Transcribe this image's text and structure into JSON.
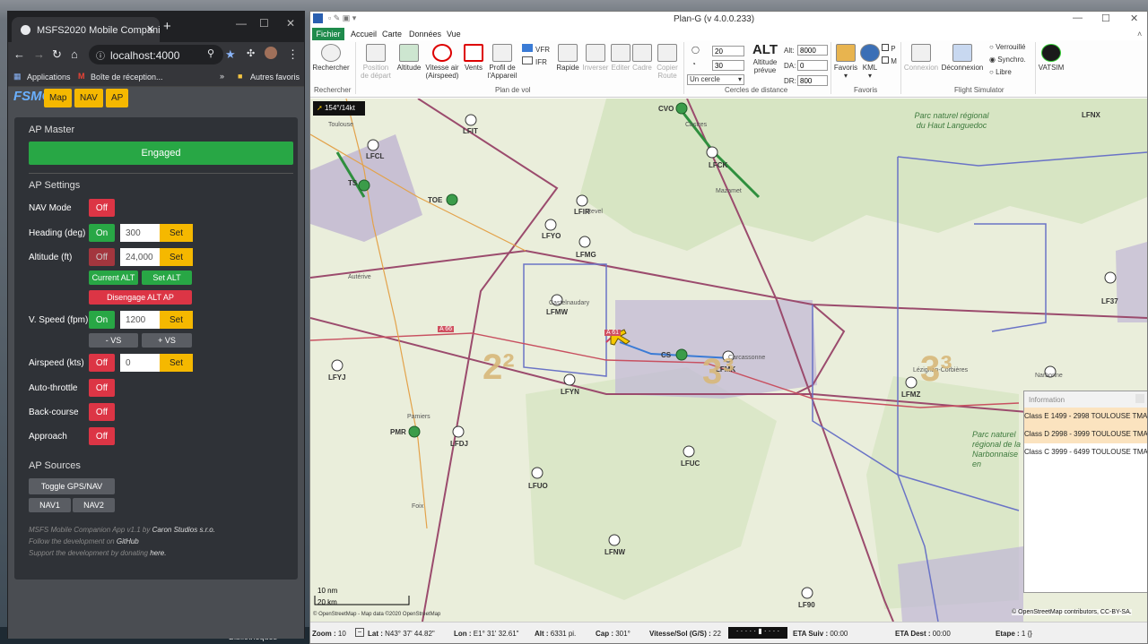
{
  "chrome": {
    "tab_title": "MSFS2020 Mobile Companion Ap",
    "url": "localhost:4000",
    "bookmarks": {
      "apps": "Applications",
      "inbox": "Boîte de réception...",
      "overflow": "»",
      "others": "Autres favoris"
    }
  },
  "companion": {
    "logo": "FSMCA",
    "nav": [
      "Map",
      "NAV",
      "AP"
    ],
    "ap_master_heading": "AP Master",
    "engaged": "Engaged",
    "ap_settings_heading": "AP Settings",
    "rows": {
      "nav_mode": {
        "label": "NAV Mode",
        "state": "Off"
      },
      "heading": {
        "label": "Heading (deg)",
        "state": "On",
        "value": "300",
        "set": "Set"
      },
      "altitude": {
        "label": "Altitude (ft)",
        "state": "Off",
        "value": "24,000",
        "set": "Set"
      },
      "vspeed": {
        "label": "V. Speed (fpm)",
        "state": "On",
        "value": "1200",
        "set": "Set"
      },
      "airspeed": {
        "label": "Airspeed (kts)",
        "state": "Off",
        "value": "0",
        "set": "Set"
      },
      "autothrottle": {
        "label": "Auto-throttle",
        "state": "Off"
      },
      "backcourse": {
        "label": "Back-course",
        "state": "Off"
      },
      "approach": {
        "label": "Approach",
        "state": "Off"
      }
    },
    "current_alt": "Current ALT",
    "set_alt": "Set ALT",
    "disengage_alt": "Disengage ALT AP",
    "minus_vs": "- VS",
    "plus_vs": "+ VS",
    "ap_sources_heading": "AP Sources",
    "toggle_gps": "Toggle GPS/NAV",
    "nav1": "NAV1",
    "nav2": "NAV2",
    "footer": {
      "line1_pre": "MSFS Mobile Companion App v1.1 by",
      "line1_link": "Caron Studios s.r.o.",
      "line2_pre": "Follow the development on",
      "line2_link": "GitHub",
      "line3_pre": "Support the development by donating",
      "line3_link": "here."
    }
  },
  "plang": {
    "title": "Plan-G (v 4.0.0.233)",
    "menu": [
      "Fichier",
      "Accueil",
      "Carte",
      "Données",
      "Vue"
    ],
    "ribbon": {
      "rechercher": "Rechercher",
      "position": "Position de départ",
      "altitude": "Altitude",
      "vitesse": "Vitesse air (Airspeed)",
      "vents": "Vents",
      "profil": "Profil de l'Appareil",
      "vfr": "VFR",
      "ifr": "IFR",
      "rapide": "Rapide",
      "inverser": "Inverser",
      "editer": "Editer",
      "cadre": "Cadre",
      "copier": "Copier Route",
      "circle1": "20",
      "circle2": "30",
      "un_cercle": "Un cercle",
      "alt_big": "ALT",
      "alt_prevue": "Altitude prévue",
      "alt_label": "Alt:",
      "alt_value": "8000",
      "da_label": "DA:",
      "da_value": "0",
      "dr_label": "DR:",
      "dr_value": "800",
      "favoris": "Favoris",
      "kml": "KML",
      "chk_p": "P",
      "chk_m": "M",
      "connexion": "Connexion",
      "deconnexion": "Déconnexion",
      "verrouille": "Verrouillé",
      "synchro": "Synchro.",
      "libre": "Libre",
      "vatsim": "VATSIM",
      "groups": [
        "Rechercher",
        "Plan de vol",
        "Cercles de distance",
        "Favoris",
        "Flight Simulator"
      ]
    },
    "map": {
      "heading_badge": "154°/14kt",
      "airports": [
        "LFIT",
        "LFCL",
        "LFCK",
        "LFIR",
        "LFYO",
        "LFMG",
        "LFMW",
        "LFMK",
        "LFMZ",
        "LFYJ",
        "LFYN",
        "LFDJ",
        "LFUC",
        "LFUO",
        "LFNW",
        "LF90",
        "LFNX",
        "LF37"
      ],
      "vors": [
        "CVO",
        "TOE",
        "TS",
        "CS",
        "PMR"
      ],
      "towns": [
        "Toulouse",
        "Castres",
        "Mazamet",
        "Revel",
        "Castelnaudary",
        "Carcassonne",
        "Narbonne",
        "Pamiers",
        "Foix",
        "Autérive",
        "Lézignan-Corbières"
      ],
      "park1": "Parc naturel régional du Haut Languedoc",
      "park2": "Parc naturel régional de la Narbonnaise en Méditerranée",
      "big2": "2²",
      "big3a": "3³",
      "big3b": "3³",
      "road_a61": "A 61",
      "road_a66": "A 66",
      "scale_nm": "10 nm",
      "scale_km": "20 km",
      "credit_left": "© OpenStreetMap - Map data ©2020 OpenStreetMap",
      "credit_right": "© OpenStreetMap contributors, CC-BY-SA."
    },
    "info": {
      "title": "Information",
      "rows": [
        {
          "text": "Class E 1499 - 2998 TOULOUSE TMA",
          "color": "#fbe3bf"
        },
        {
          "text": "Class D 2998 - 3999 TOULOUSE TMA",
          "color": "#fbe3bf"
        },
        {
          "text": "Class C 3999 - 6499 TOULOUSE TMA",
          "color": "#ffffff"
        }
      ]
    },
    "status": {
      "zoom_label": "Zoom :",
      "zoom_value": "10",
      "lat_label": "Lat :",
      "lat_value": "N43° 37' 44.82\"",
      "lon_label": "Lon :",
      "lon_value": "E1° 31' 32.61\"",
      "alt_label": "Alt :",
      "alt_value": "6331 pi.",
      "cap_label": "Cap :",
      "cap_value": "301°",
      "vs_label": "Vitesse/Sol (G/S) :",
      "vs_value": "22",
      "eta_suiv_label": "ETA Suiv :",
      "eta_suiv_value": "00:00",
      "eta_dest_label": "ETA Dest :",
      "eta_dest_value": "00:00",
      "etape_label": "Etape :",
      "etape_value": "1 {}"
    }
  },
  "desktop": {
    "taskbar_item": "Bibliothèques"
  }
}
